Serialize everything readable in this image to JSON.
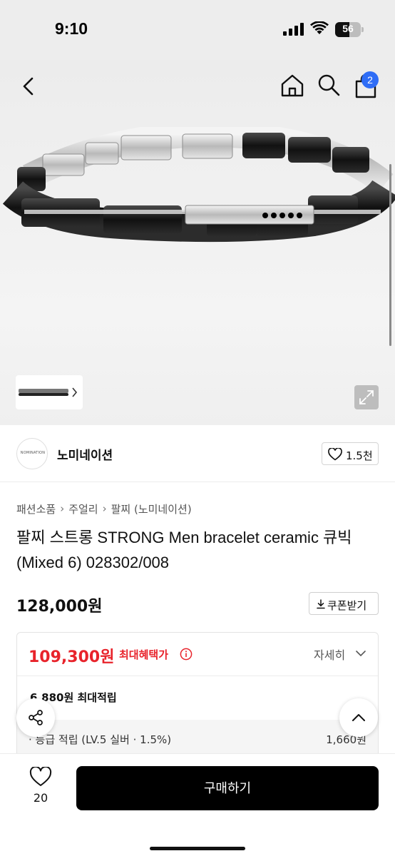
{
  "status_bar": {
    "time": "9:10",
    "battery_level": "56",
    "battery_fraction": 0.56,
    "signal_icon": "cellular-signal-icon",
    "wifi_icon": "wifi-icon"
  },
  "header": {
    "back_icon": "chevron-left-icon",
    "home_icon": "home-icon",
    "search_icon": "search-icon",
    "cart_icon": "shopping-bag-icon",
    "cart_badge": "2"
  },
  "gallery": {
    "thumbnail_chevron_icon": "chevron-right-icon",
    "expand_icon": "expand-icon"
  },
  "brand": {
    "logo_text": "NOMINATION",
    "name": "노미네이션",
    "like_count": "1.5천",
    "like_icon": "heart-outline-icon"
  },
  "breadcrumb": [
    "패션소품",
    "주얼리",
    "팔찌 (노미네이션)"
  ],
  "product": {
    "title": "팔찌 스트롱 STRONG Men bracelet ceramic 큐빅 (Mixed 6) 028302/008",
    "price": "128,000원",
    "coupon_label": "쿠폰받기",
    "coupon_icon": "download-icon"
  },
  "benefit": {
    "max_price": "109,300원",
    "max_label": "최대혜택가",
    "info_icon": "info-circle-icon",
    "detail_label": "자세히",
    "detail_icon": "chevron-down-icon",
    "points_label": "6,880원 최대적립",
    "grade_label": "· 등급 적립 (LV.5 실버 · 1.5%)",
    "grade_value": "1,660원"
  },
  "fabs": {
    "share_icon": "share-icon",
    "top_icon": "chevron-up-icon"
  },
  "bottom_bar": {
    "wish_count": "20",
    "wish_icon": "heart-outline-icon",
    "buy_label": "구매하기"
  },
  "colors": {
    "accent_red": "#e8232b",
    "badge_blue": "#2f6df6",
    "buy_button": "#000000"
  }
}
